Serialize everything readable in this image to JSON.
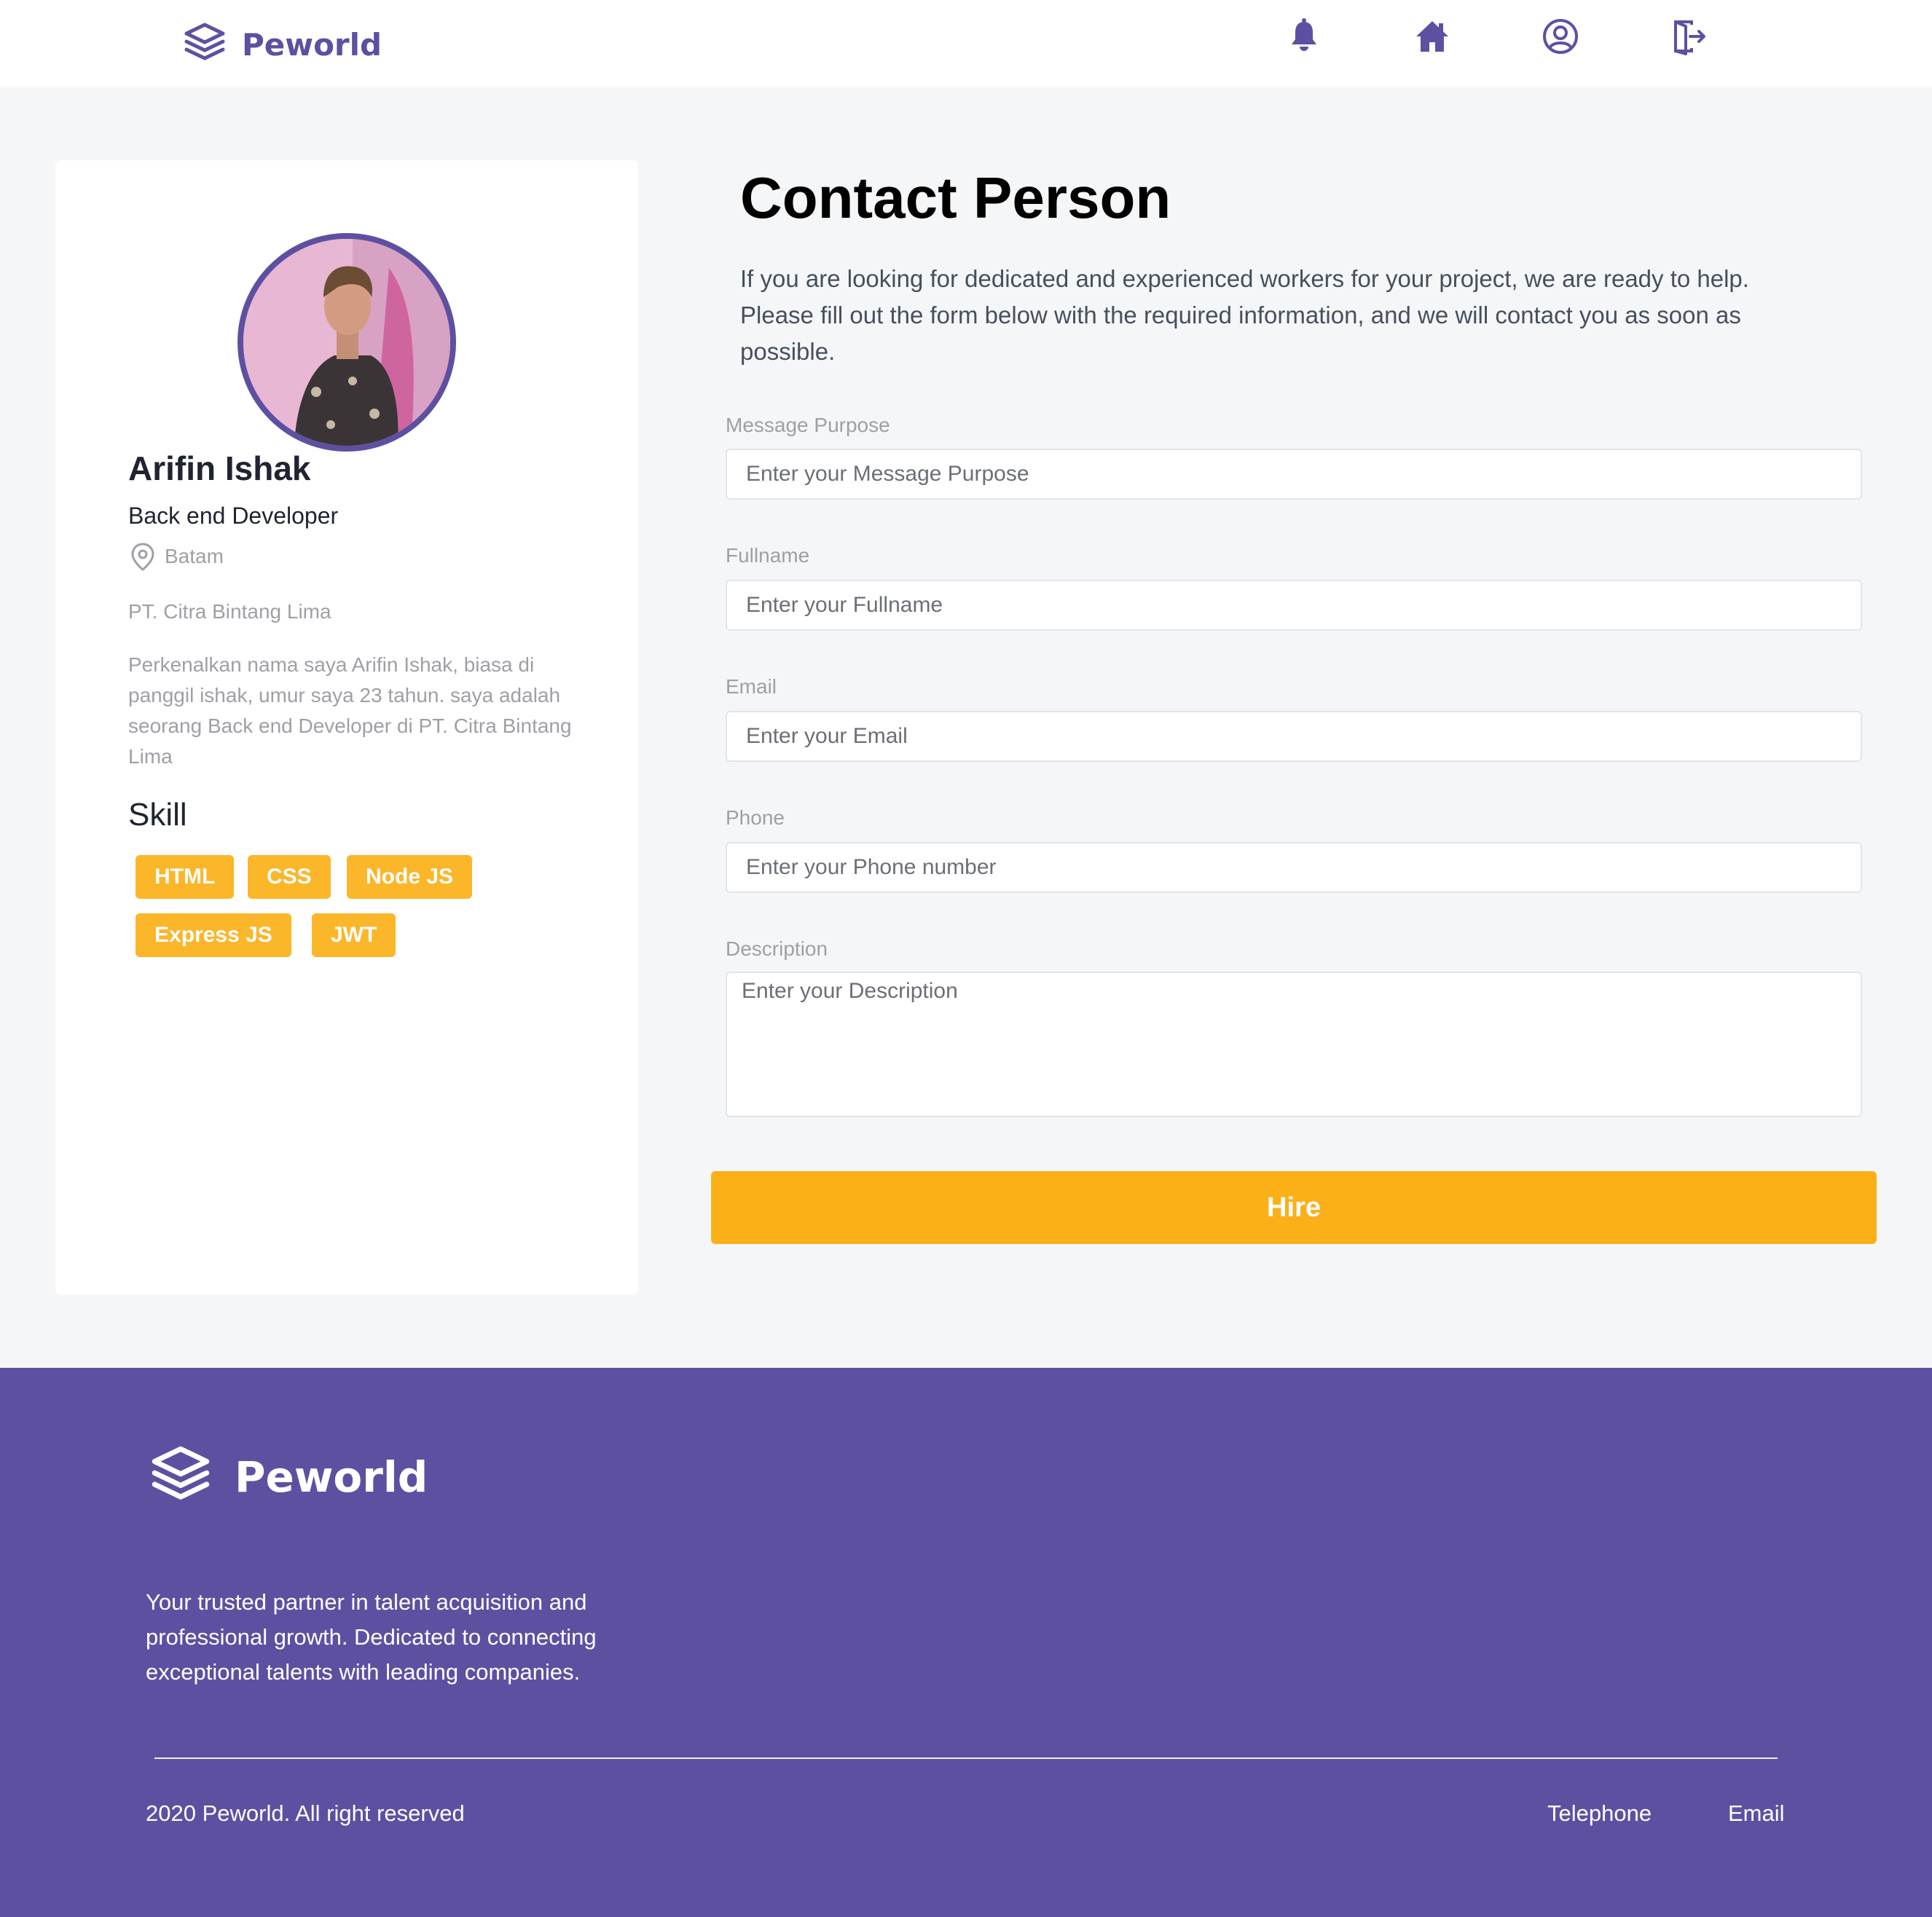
{
  "brand": {
    "name": "Peworld",
    "color": "#5e50a1",
    "logo_icon": "layers-logo-icon"
  },
  "nav": {
    "icons": [
      "bell-icon",
      "home-icon",
      "user-circle-icon",
      "logout-icon"
    ]
  },
  "profile": {
    "name": "Arifin Ishak",
    "role": "Back end Developer",
    "location": "Batam",
    "location_icon": "map-pin-icon",
    "company": "PT. Citra Bintang Lima",
    "bio": "Perkenalkan nama saya Arifin Ishak, biasa di panggil ishak, umur saya 23 tahun. saya adalah seorang Back end Developer di PT. Citra Bintang Lima",
    "skill_title": "Skill",
    "skills": [
      "HTML",
      "CSS",
      "Node JS",
      "Express JS",
      "JWT"
    ]
  },
  "contact": {
    "title": "Contact Person",
    "description": "If you are looking for dedicated and experienced workers for your project, we are ready to help. Please fill out the form below with the required information, and we will contact you as soon as possible.",
    "fields": [
      {
        "label": "Message Purpose",
        "placeholder": "Enter your Message Purpose",
        "value": ""
      },
      {
        "label": "Fullname",
        "placeholder": "Enter your Fullname",
        "value": ""
      },
      {
        "label": "Email",
        "placeholder": "Enter your Email",
        "value": ""
      },
      {
        "label": "Phone",
        "placeholder": "Enter your Phone number",
        "value": ""
      }
    ],
    "description_field": {
      "label": "Description",
      "placeholder": "Enter your Description",
      "value": ""
    },
    "submit_label": "Hire"
  },
  "footer": {
    "brand": "Peworld",
    "tagline": "Your trusted partner in talent acquisition and professional growth. Dedicated to connecting exceptional talents with leading companies.",
    "copyright": "2020 Peworld. All right reserved",
    "links": [
      "Telephone",
      "Email"
    ]
  },
  "colors": {
    "accent": "#5e50a1",
    "button": "#fbb017",
    "page_bg": "#f5f6f8",
    "muted_text": "#9ea0a5"
  }
}
